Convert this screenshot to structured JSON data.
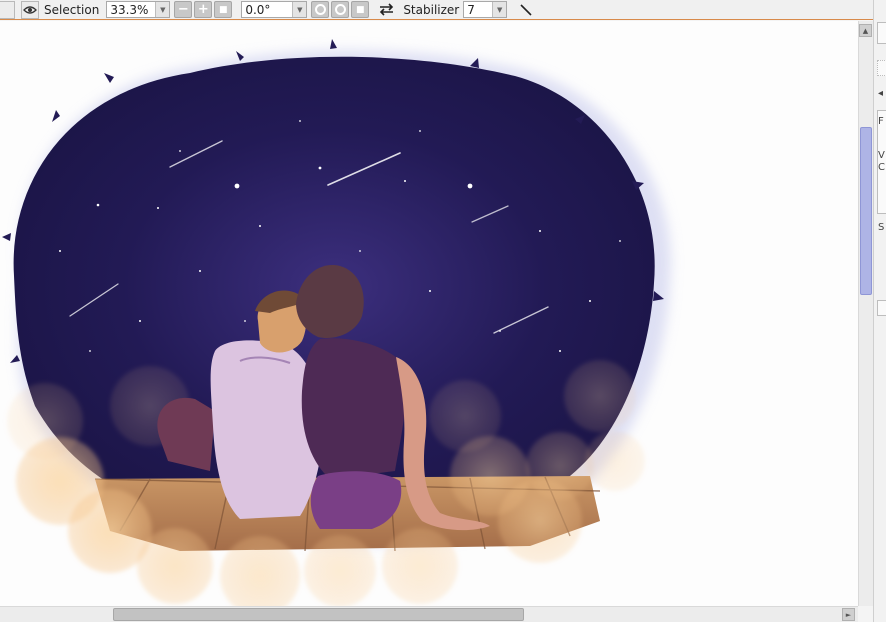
{
  "toolbar": {
    "selection_label": "Selection",
    "zoom_value": "33.3%",
    "zoom_out_label": "−",
    "zoom_in_label": "+",
    "zoom_reset_label": "■",
    "rotation_value": "0.0°",
    "rotate_stop_label": "■",
    "stabilizer_label": "Stabilizer",
    "stabilizer_value": "7"
  },
  "right_panel": {
    "labels": [
      "F",
      "V",
      "C",
      "S"
    ]
  },
  "colors": {
    "toolbar_border": "#d88a4a",
    "scroll_thumb": "#aeb4e6",
    "night_sky": "#20184a",
    "bokeh": "#f3c07d"
  },
  "icons": [
    "eye-icon",
    "zoom-out-icon",
    "zoom-in-icon",
    "rotate-ccw-icon",
    "rotate-cw-icon",
    "flip-icon",
    "line-icon"
  ]
}
